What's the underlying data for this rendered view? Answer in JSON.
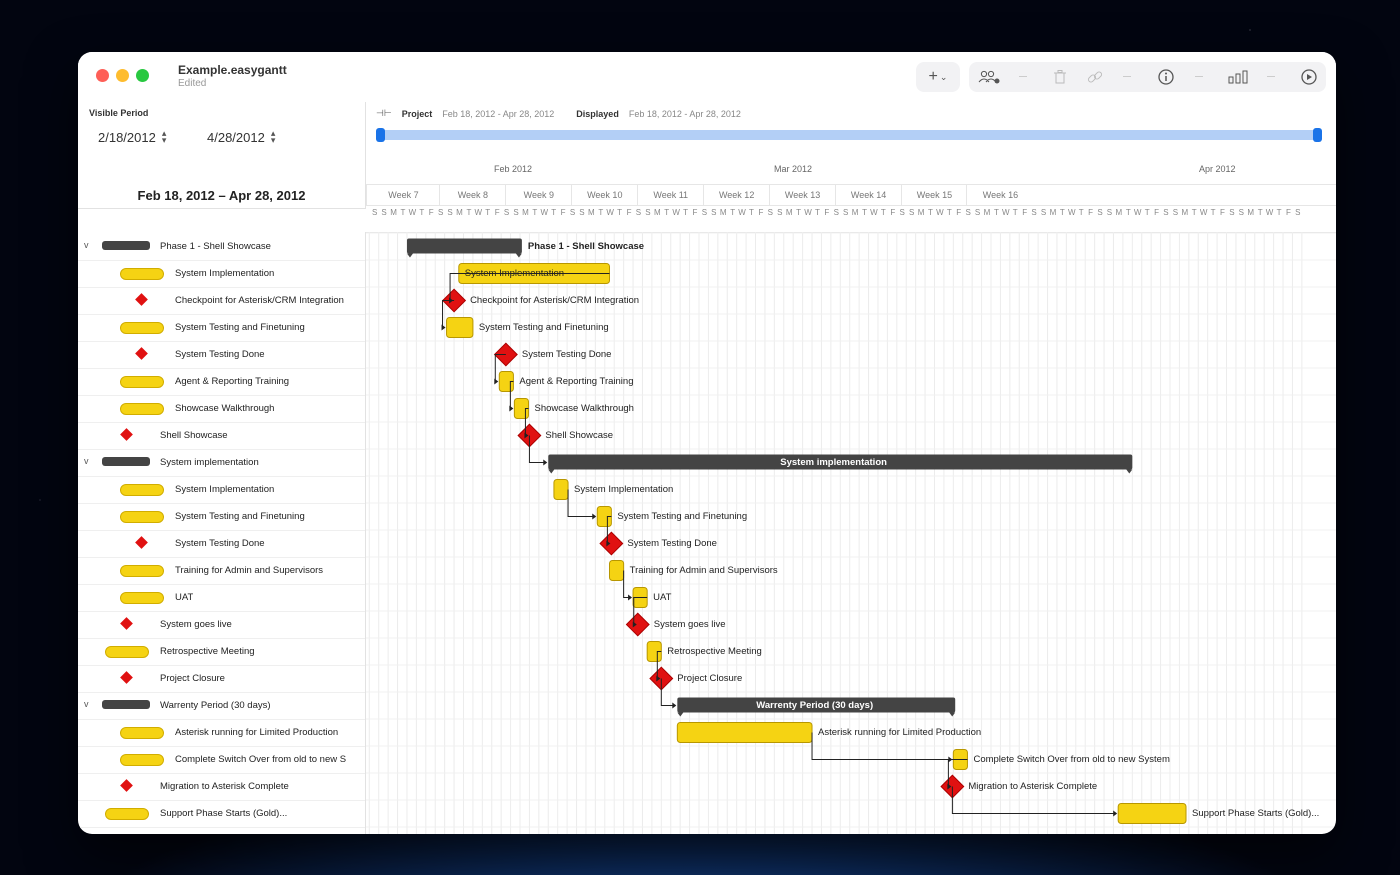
{
  "window": {
    "title": "Example.easygantt",
    "subtitle": "Edited"
  },
  "toolbar": {
    "add_label": "+",
    "chevron": "⌄",
    "buttons": [
      "add-icon",
      "people-icon",
      "trash-icon",
      "link-icon",
      "info-icon",
      "chart-icon",
      "play-icon"
    ]
  },
  "visible_period": {
    "label": "Visible Period",
    "start": "2/18/2012",
    "end": "4/28/2012"
  },
  "range_title": "Feb 18, 2012 – Apr 28, 2012",
  "project_info": {
    "project_label": "Project",
    "project_range": "Feb 18, 2012 - Apr 28, 2012",
    "displayed_label": "Displayed",
    "displayed_range": "Feb 18, 2012 - Apr 28, 2012"
  },
  "timeline": {
    "months": [
      "Feb 2012",
      "Mar 2012",
      "Apr 2012"
    ],
    "weeks": [
      "Week 7",
      "Week 8",
      "Week 9",
      "Week 10",
      "Week 11",
      "Week 12",
      "Week 13",
      "Week 14",
      "Week 15",
      "Week 16"
    ],
    "days": [
      "S",
      "S",
      "M",
      "T",
      "W",
      "T",
      "F",
      "S",
      "S",
      "M",
      "T",
      "W",
      "T",
      "F",
      "S",
      "S",
      "M",
      "T",
      "W",
      "T",
      "F",
      "S",
      "S",
      "M",
      "T",
      "W",
      "T",
      "F",
      "S",
      "S",
      "M",
      "T",
      "W",
      "T",
      "F",
      "S",
      "S",
      "M",
      "T",
      "W",
      "T",
      "F",
      "S",
      "S",
      "M",
      "T",
      "W",
      "T",
      "F",
      "S",
      "S",
      "M",
      "T",
      "W",
      "T",
      "F",
      "S",
      "S",
      "M",
      "T",
      "W",
      "T",
      "F",
      "S",
      "S",
      "M",
      "T",
      "W",
      "T",
      "F",
      "S",
      "S",
      "M",
      "T",
      "W",
      "T",
      "F",
      "S",
      "S",
      "M",
      "T",
      "W",
      "T",
      "F",
      "S",
      "S",
      "M",
      "T",
      "W",
      "T",
      "F",
      "S",
      "S",
      "M",
      "T",
      "W",
      "T",
      "F",
      "S"
    ]
  },
  "tasks": [
    {
      "name": "Phase 1 - Shell Showcase",
      "type": "summary",
      "level": 0,
      "bar_label": "Phase 1 - Shell Showcase"
    },
    {
      "name": "System Implementation",
      "type": "task",
      "level": 1,
      "bar_label": "System Implementation"
    },
    {
      "name": "Checkpoint for Asterisk/CRM Integration",
      "type": "milestone",
      "level": 1,
      "bar_label": "Checkpoint for Asterisk/CRM Integration"
    },
    {
      "name": "System Testing and Finetuning",
      "type": "task",
      "level": 1,
      "bar_label": "System Testing and Finetuning"
    },
    {
      "name": "System Testing Done",
      "type": "milestone",
      "level": 1,
      "bar_label": "System Testing Done"
    },
    {
      "name": "Agent & Reporting Training",
      "type": "task",
      "level": 1,
      "bar_label": "Agent & Reporting Training"
    },
    {
      "name": "Showcase Walkthrough",
      "type": "task",
      "level": 1,
      "bar_label": "Showcase Walkthrough"
    },
    {
      "name": "Shell Showcase",
      "type": "milestone",
      "level": 0,
      "bar_label": "Shell Showcase"
    },
    {
      "name": "System implementation",
      "type": "summary",
      "level": 0,
      "bar_label": "System implementation"
    },
    {
      "name": "System Implementation",
      "type": "task",
      "level": 1,
      "bar_label": "System Implementation"
    },
    {
      "name": "System Testing and Finetuning",
      "type": "task",
      "level": 1,
      "bar_label": "System Testing and Finetuning"
    },
    {
      "name": "System Testing Done",
      "type": "milestone",
      "level": 1,
      "bar_label": "System Testing Done"
    },
    {
      "name": "Training for Admin and Supervisors",
      "type": "task",
      "level": 1,
      "bar_label": "Training for Admin and Supervisors"
    },
    {
      "name": "UAT",
      "type": "task",
      "level": 1,
      "bar_label": "UAT"
    },
    {
      "name": "System goes live",
      "type": "milestone",
      "level": 0,
      "bar_label": "System goes live"
    },
    {
      "name": "Retrospective Meeting",
      "type": "task",
      "level": 0,
      "bar_label": "Retrospective Meeting"
    },
    {
      "name": "Project Closure",
      "type": "milestone",
      "level": 0,
      "bar_label": "Project Closure"
    },
    {
      "name": "Warrenty Period (30 days)",
      "type": "summary",
      "level": 0,
      "bar_label": "Warrenty Period (30 days)"
    },
    {
      "name": "Asterisk running for Limited Production",
      "type": "task",
      "level": 1,
      "bar_label": "Asterisk running for Limited Production"
    },
    {
      "name": "Complete Switch Over from old to new S",
      "type": "task",
      "level": 1,
      "bar_label": "Complete Switch Over from old to new System"
    },
    {
      "name": "Migration to Asterisk Complete",
      "type": "milestone",
      "level": 0,
      "bar_label": "Migration to Asterisk Complete"
    },
    {
      "name": "Support Phase Starts (Gold)...",
      "type": "task",
      "level": 0,
      "bar_label": "Support Phase Starts (Gold)..."
    }
  ],
  "colors": {
    "task": "#f5d313",
    "milestone": "#e01111",
    "summary": "#444444",
    "accent": "#1a73e8"
  }
}
